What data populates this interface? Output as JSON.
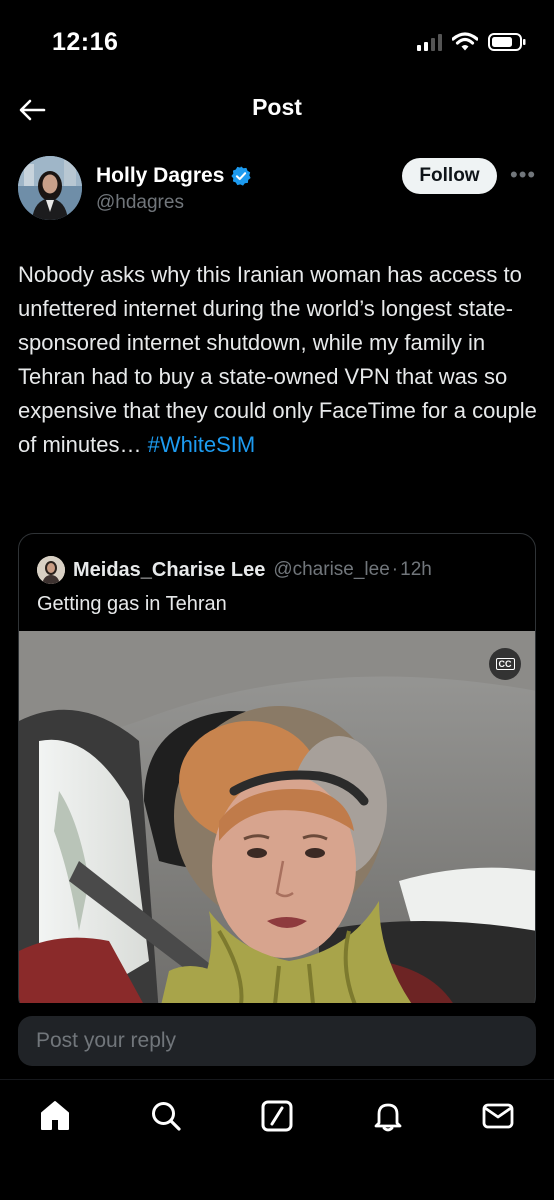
{
  "status_bar": {
    "time": "12:16"
  },
  "header": {
    "title": "Post",
    "back_icon": "back-arrow-icon"
  },
  "post": {
    "author_name": "Holly Dagres",
    "author_handle": "@hdagres",
    "verified": true,
    "follow_label": "Follow",
    "more_label": "•••",
    "text_body": "Nobody asks why this Iranian woman has access to unfettered internet during the world’s longest state-sponsored internet shutdown, while my family in Tehran had to buy a state-owned VPN that was so expensive that they could only FaceTime for a couple of minutes… ",
    "hashtag": "#WhiteSIM"
  },
  "quote": {
    "author_name": "Meidas_Charise Lee",
    "author_handle": "@charise_lee",
    "separator": "·",
    "time_ago": "12h",
    "text": "Getting gas in Tehran",
    "cc_label": "CC"
  },
  "reply": {
    "placeholder": "Post your reply"
  },
  "nav": {
    "items": [
      "home-icon",
      "search-icon",
      "grok-icon",
      "notifications-icon",
      "messages-icon"
    ]
  },
  "colors": {
    "background": "#000000",
    "text": "#e7e9ea",
    "secondary_text": "#71767b",
    "accent": "#1d9bf0"
  }
}
